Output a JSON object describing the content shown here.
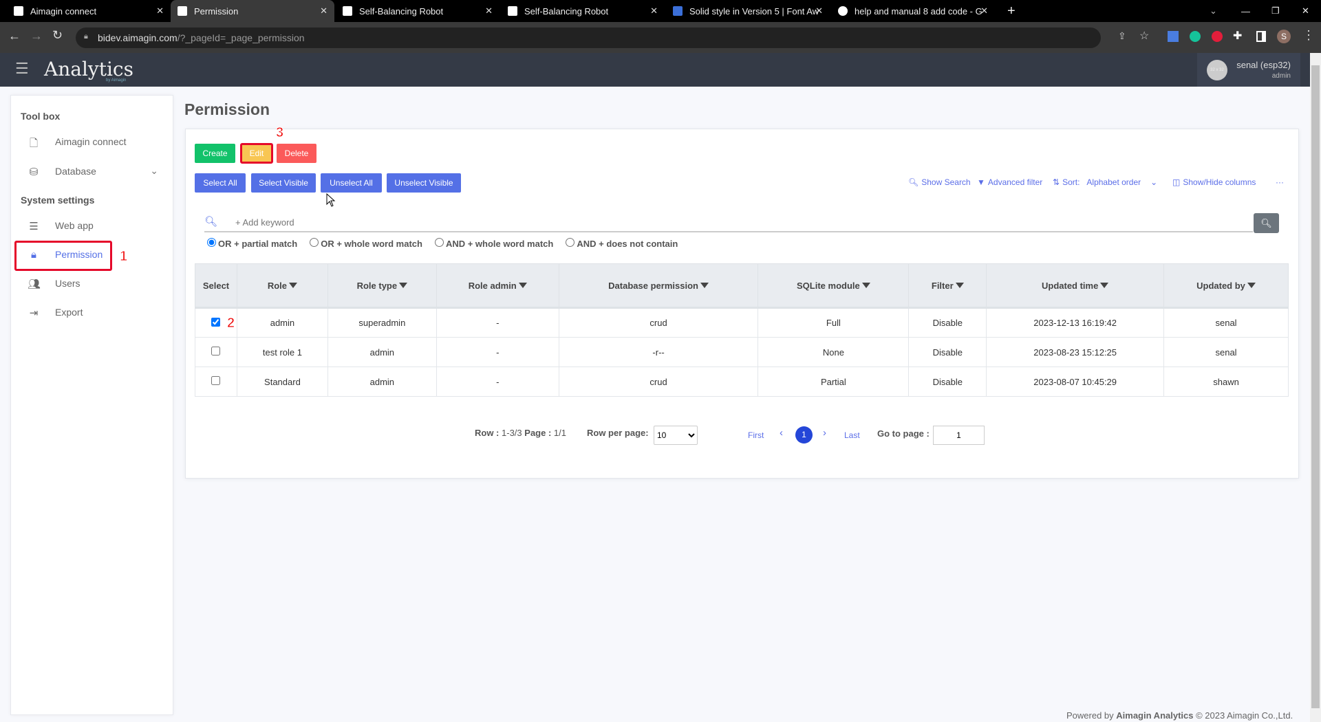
{
  "browser": {
    "tabs": [
      {
        "title": "Aimagin connect",
        "active": false
      },
      {
        "title": "Permission",
        "active": true
      },
      {
        "title": "Self-Balancing Robot",
        "active": false
      },
      {
        "title": "Self-Balancing Robot",
        "active": false
      },
      {
        "title": "Solid style in Version 5 | Font Aw",
        "active": false
      },
      {
        "title": "help and manual 8 add code - G",
        "active": false
      }
    ],
    "url_host": "bidev.aimagin.com",
    "url_path": "/?_pageId=_page_permission",
    "profile_initial": "S"
  },
  "app": {
    "logo": "Analytics",
    "logo_sub": "by Aimagin",
    "user_name": "senal (esp32)",
    "user_role": "admin",
    "avatar_placeholder": "32 x 32"
  },
  "sidebar": {
    "toolbox_heading": "Tool box",
    "toolbox_items": [
      {
        "label": "Aimagin connect",
        "icon": "file-code-icon"
      },
      {
        "label": "Database",
        "icon": "database-icon"
      }
    ],
    "system_heading": "System settings",
    "system_items": [
      {
        "label": "Web app",
        "icon": "server-icon"
      },
      {
        "label": "Permission",
        "icon": "lock-icon",
        "active": true
      },
      {
        "label": "Users",
        "icon": "users-icon"
      },
      {
        "label": "Export",
        "icon": "export-icon"
      }
    ]
  },
  "page": {
    "title": "Permission"
  },
  "actions": {
    "create": "Create",
    "edit": "Edit",
    "delete": "Delete",
    "select_all": "Select All",
    "select_visible": "Select Visible",
    "unselect_all": "Unselect All",
    "unselect_visible": "Unselect Visible"
  },
  "tools": {
    "show_search": "Show Search",
    "advanced_filter": "Advanced filter",
    "sort_label": "Sort:",
    "sort_value": "Alphabet order",
    "show_hide": "Show/Hide columns",
    "more": "···"
  },
  "search": {
    "placeholder": "+ Add keyword",
    "modes": [
      "OR + partial match",
      "OR + whole word match",
      "AND + whole word match",
      "AND + does not contain"
    ],
    "selected_mode": 0
  },
  "table": {
    "columns": [
      "Select",
      "Role",
      "Role type",
      "Role admin",
      "Database permission",
      "SQLite module",
      "Filter",
      "Updated time",
      "Updated by"
    ],
    "rows": [
      {
        "checked": true,
        "cells": [
          "admin",
          "superadmin",
          "-",
          "crud",
          "Full",
          "Disable",
          "2023-12-13 16:19:42",
          "senal"
        ]
      },
      {
        "checked": false,
        "cells": [
          "test role 1",
          "admin",
          "-",
          "-r--",
          "None",
          "Disable",
          "2023-08-23 15:12:25",
          "senal"
        ]
      },
      {
        "checked": false,
        "cells": [
          "Standard",
          "admin",
          "-",
          "crud",
          "Partial",
          "Disable",
          "2023-08-07 10:45:29",
          "shawn"
        ]
      }
    ]
  },
  "pagination": {
    "row_label": "Row :",
    "row_value": "1-3/3",
    "page_label": "Page :",
    "page_value": "1/1",
    "per_page_label": "Row per page:",
    "per_page": "10",
    "first": "First",
    "last": "Last",
    "current": "1",
    "goto_label": "Go to page :",
    "goto_value": "1"
  },
  "annotations": {
    "a1": "1",
    "a2": "2",
    "a3": "3"
  },
  "footer": {
    "prefix": "Powered by ",
    "brand": "Aimagin Analytics",
    "suffix": " © 2023 Aimagin Co.,Ltd."
  },
  "colors": {
    "create": "#12c26a",
    "edit": "#f8c653",
    "delete": "#fb5a5a",
    "primary": "#5470e6",
    "annotation": "#e5092a"
  }
}
